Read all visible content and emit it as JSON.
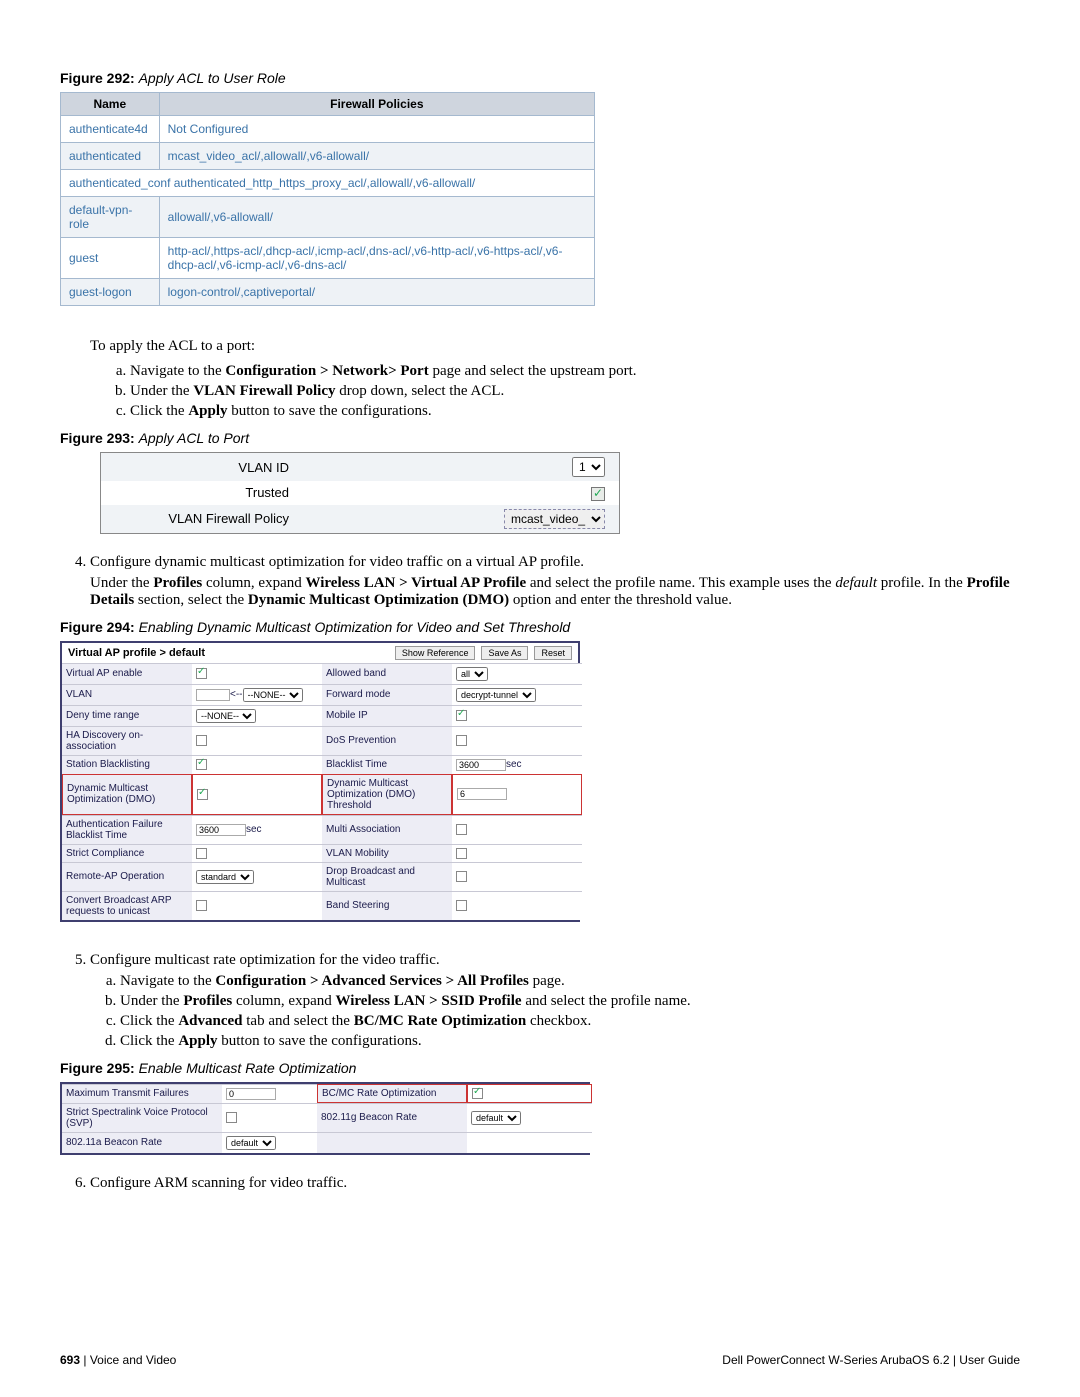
{
  "fig292": {
    "num": "Figure 292:",
    "title": "Apply ACL to User Role",
    "headers": {
      "name": "Name",
      "policies": "Firewall Policies"
    },
    "rows": [
      {
        "name": "authenticate4d",
        "policy": "Not Configured"
      },
      {
        "name": "authenticated",
        "policy": "mcast_video_acl/,allowall/,v6-allowall/"
      },
      {
        "name": "authenticated_conf",
        "policy": "authenticated_http_https_proxy_acl/,allowall/,v6-allowall/"
      },
      {
        "name": "default-vpn-role",
        "policy": "allowall/,v6-allowall/"
      },
      {
        "name": "guest",
        "policy": "http-acl/,https-acl/,dhcp-acl/,icmp-acl/,dns-acl/,v6-http-acl/,v6-https-acl/,v6-dhcp-acl/,v6-icmp-acl/,v6-dns-acl/"
      },
      {
        "name": "guest-logon",
        "policy": "logon-control/,captiveportal/"
      }
    ]
  },
  "para_apply_port": "To apply the ACL to a port:",
  "steps_a": {
    "a_prefix": "Navigate to the ",
    "a_bold": "Configuration > Network> Port",
    "a_suffix": " page and select the upstream port.",
    "b_prefix": "Under the ",
    "b_bold": "VLAN Firewall Policy",
    "b_suffix": " drop down, select the ACL.",
    "c_prefix": "Click the ",
    "c_bold": "Apply",
    "c_suffix": " button to save the configurations."
  },
  "fig293": {
    "num": "Figure 293:",
    "title": "Apply ACL to Port",
    "rows": {
      "vlan_id_label": "VLAN ID",
      "vlan_id_value": "1",
      "trusted_label": "Trusted",
      "fwpolicy_label": "VLAN Firewall Policy",
      "fwpolicy_value": "mcast_video_"
    }
  },
  "step4": {
    "lead": "Configure dynamic multicast optimization for video traffic on a virtual AP profile.",
    "p1a": "Under the ",
    "p1b": "Profiles",
    "p1c": " column, expand ",
    "p1d": "Wireless LAN > Virtual AP Profile",
    "p1e": " and select the profile name. This example uses the ",
    "p1f": "default",
    "p1g": " profile. In the ",
    "p1h": "Profile Details",
    "p1i": " section, select the ",
    "p1j": "Dynamic Multicast Optimization (DMO)",
    "p1k": " option and enter the threshold value."
  },
  "fig294": {
    "num": "Figure 294:",
    "title": "Enabling Dynamic Multicast Optimization for Video and Set Threshold",
    "header_title": "Virtual AP profile > default",
    "btn_show": "Show Reference",
    "btn_save": "Save As",
    "btn_reset": "Reset",
    "rows": [
      {
        "l": "Virtual AP enable",
        "lv": {
          "type": "check",
          "checked": true
        },
        "r": "Allowed band",
        "rv": {
          "type": "select",
          "value": "all"
        }
      },
      {
        "l": "VLAN",
        "lv": {
          "type": "vlan",
          "value": "--NONE--"
        },
        "r": "Forward mode",
        "rv": {
          "type": "select",
          "value": "decrypt-tunnel"
        }
      },
      {
        "l": "Deny time range",
        "lv": {
          "type": "select",
          "value": "--NONE--"
        },
        "r": "Mobile IP",
        "rv": {
          "type": "check",
          "checked": true
        }
      },
      {
        "l": "HA Discovery on-association",
        "lv": {
          "type": "check",
          "checked": false
        },
        "r": "DoS Prevention",
        "rv": {
          "type": "check",
          "checked": false
        }
      },
      {
        "l": "Station Blacklisting",
        "lv": {
          "type": "check",
          "checked": true
        },
        "r": "Blacklist Time",
        "rv": {
          "type": "input-sec",
          "value": "3600"
        }
      },
      {
        "l": "Dynamic Multicast Optimization (DMO)",
        "lv": {
          "type": "check",
          "checked": true
        },
        "r": "Dynamic Multicast Optimization (DMO) Threshold",
        "rv": {
          "type": "input",
          "value": "6"
        },
        "highlight": true
      },
      {
        "l": "Authentication Failure Blacklist Time",
        "lv": {
          "type": "input-sec",
          "value": "3600"
        },
        "r": "Multi Association",
        "rv": {
          "type": "check",
          "checked": false
        }
      },
      {
        "l": "Strict Compliance",
        "lv": {
          "type": "check",
          "checked": false
        },
        "r": "VLAN Mobility",
        "rv": {
          "type": "check",
          "checked": false
        }
      },
      {
        "l": "Remote-AP Operation",
        "lv": {
          "type": "select",
          "value": "standard"
        },
        "r": "Drop Broadcast and Multicast",
        "rv": {
          "type": "check",
          "checked": false
        }
      },
      {
        "l": "Convert Broadcast ARP requests to unicast",
        "lv": {
          "type": "check",
          "checked": false
        },
        "r": "Band Steering",
        "rv": {
          "type": "check",
          "checked": false
        }
      }
    ]
  },
  "step5": {
    "lead": "Configure multicast rate optimization for the video traffic.",
    "a_prefix": "Navigate to the ",
    "a_bold": "Configuration > Advanced Services > All Profiles",
    "a_suffix": " page.",
    "b_prefix": "Under the ",
    "b_bold1": "Profiles",
    "b_mid": " column, expand ",
    "b_bold2": "Wireless LAN > SSID Profile",
    "b_suffix": " and select the profile name.",
    "c_prefix": "Click the ",
    "c_bold1": "Advanced",
    "c_mid": " tab and select the ",
    "c_bold2": "BC/MC Rate Optimization",
    "c_suffix": " checkbox.",
    "d_prefix": "Click the ",
    "d_bold": "Apply",
    "d_suffix": " button to save the configurations."
  },
  "fig295": {
    "num": "Figure 295:",
    "title": "Enable Multicast Rate Optimization",
    "rows": [
      {
        "l": "Maximum Transmit Failures",
        "lv": {
          "type": "input",
          "value": "0"
        },
        "r": "BC/MC Rate Optimization",
        "rv": {
          "type": "check",
          "checked": true
        },
        "highlight": true
      },
      {
        "l": "Strict Spectralink Voice Protocol (SVP)",
        "lv": {
          "type": "check",
          "checked": false
        },
        "r": "802.11g Beacon Rate",
        "rv": {
          "type": "select",
          "value": "default"
        }
      },
      {
        "l": "802.11a Beacon Rate",
        "lv": {
          "type": "select",
          "value": "default"
        },
        "r": "",
        "rv": {
          "type": "none"
        }
      }
    ]
  },
  "step6": "Configure ARM scanning for video traffic.",
  "footer": {
    "page": "693",
    "section": "Voice and Video",
    "right": "Dell PowerConnect W-Series ArubaOS 6.2  |  User Guide",
    "sep": " | "
  },
  "labels": {
    "sec": "sec"
  }
}
